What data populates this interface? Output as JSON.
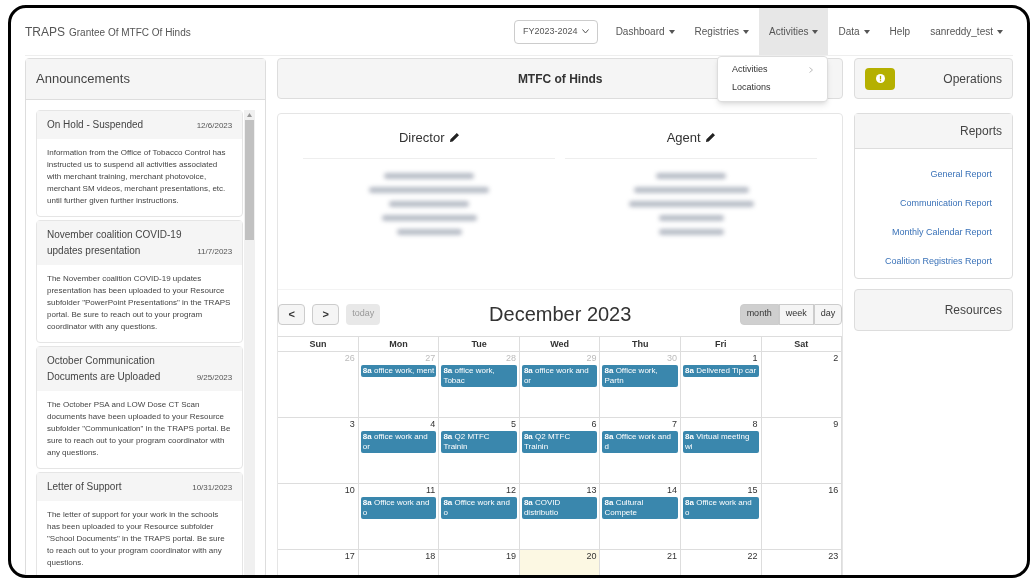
{
  "header": {
    "brand": "TRAPS",
    "subtitle": "Grantee Of MTFC Of Hinds",
    "fiscal_year": "FY2023-2024",
    "nav": [
      {
        "label": "Dashboard",
        "caret": true,
        "expanded": false
      },
      {
        "label": "Registries",
        "caret": true,
        "expanded": false
      },
      {
        "label": "Activities",
        "caret": true,
        "expanded": true
      },
      {
        "label": "Data",
        "caret": true,
        "expanded": false
      },
      {
        "label": "Help",
        "caret": false,
        "expanded": false
      },
      {
        "label": "sanreddy_test",
        "caret": true,
        "expanded": false
      }
    ],
    "dropdown": [
      {
        "label": "Activities",
        "submenu": true
      },
      {
        "label": "Locations",
        "submenu": false
      }
    ]
  },
  "announcements": {
    "title": "Announcements",
    "items": [
      {
        "title": "On Hold - Suspended",
        "date": "12/6/2023",
        "body": "Information from the Office of Tobacco Control has instructed us to suspend all activities associated with merchant training, merchant photovoice, merchant SM videos, merchant presentations, etc. until further given further instructions."
      },
      {
        "title": "November coalition COVID-19 updates presentation",
        "date": "11/7/2023",
        "body": "The November coalition COVID-19 updates presentation has been uploaded to your Resource subfolder \"PowerPoint Presentations\" in the TRAPS portal. Be sure to reach out to your program coordinator with any questions."
      },
      {
        "title": "October Communication Documents are Uploaded",
        "date": "9/25/2023",
        "body": "The October PSA and LOW Dose CT Scan documents have been uploaded to your Resource subfolder \"Communication\" in the TRAPS portal. Be sure to reach out to your program coordinator with any questions."
      },
      {
        "title": "Letter of Support",
        "date": "10/31/2023",
        "body": "The letter of support for your work in the schools has been uploaded to your Resource subfolder \"School Documents\" in the TRAPS portal. Be sure to reach out to your program coordinator with any questions."
      }
    ]
  },
  "org": {
    "title": "MTFC of Hinds",
    "contacts": [
      {
        "role": "Director"
      },
      {
        "role": "Agent"
      }
    ]
  },
  "calendar": {
    "title": "December 2023",
    "prev": "<",
    "next": ">",
    "today": "today",
    "views": [
      {
        "label": "month",
        "selected": true
      },
      {
        "label": "week",
        "selected": false
      },
      {
        "label": "day",
        "selected": false
      }
    ],
    "weekdays": [
      "Sun",
      "Mon",
      "Tue",
      "Wed",
      "Thu",
      "Fri",
      "Sat"
    ],
    "weeks": [
      [
        {
          "day": "26",
          "other_month": true,
          "today": false
        },
        {
          "day": "27",
          "other_month": true,
          "today": false,
          "events": [
            {
              "time": "8a",
              "title": "office work, ment"
            }
          ]
        },
        {
          "day": "28",
          "other_month": true,
          "today": false,
          "events": [
            {
              "time": "8a",
              "title": "office work, Tobac"
            }
          ]
        },
        {
          "day": "29",
          "other_month": true,
          "today": false,
          "events": [
            {
              "time": "8a",
              "title": "office work and or"
            }
          ]
        },
        {
          "day": "30",
          "other_month": true,
          "today": false,
          "events": [
            {
              "time": "8a",
              "title": "Office work, Partn"
            }
          ]
        },
        {
          "day": "1",
          "other_month": false,
          "today": false,
          "events": [
            {
              "time": "8a",
              "title": "Delivered Tip car"
            }
          ]
        },
        {
          "day": "2",
          "other_month": false,
          "today": false
        }
      ],
      [
        {
          "day": "3",
          "other_month": false,
          "today": false
        },
        {
          "day": "4",
          "other_month": false,
          "today": false,
          "events": [
            {
              "time": "8a",
              "title": "office work and or"
            }
          ]
        },
        {
          "day": "5",
          "other_month": false,
          "today": false,
          "events": [
            {
              "time": "8a",
              "title": "Q2 MTFC Trainin"
            }
          ]
        },
        {
          "day": "6",
          "other_month": false,
          "today": false,
          "events": [
            {
              "time": "8a",
              "title": "Q2 MTFC Trainin"
            }
          ]
        },
        {
          "day": "7",
          "other_month": false,
          "today": false,
          "events": [
            {
              "time": "8a",
              "title": "Office work and d"
            }
          ]
        },
        {
          "day": "8",
          "other_month": false,
          "today": false,
          "events": [
            {
              "time": "8a",
              "title": "Virtual meeting wi"
            }
          ]
        },
        {
          "day": "9",
          "other_month": false,
          "today": false
        }
      ],
      [
        {
          "day": "10",
          "other_month": false,
          "today": false
        },
        {
          "day": "11",
          "other_month": false,
          "today": false,
          "events": [
            {
              "time": "8a",
              "title": "Office work and o"
            }
          ]
        },
        {
          "day": "12",
          "other_month": false,
          "today": false,
          "events": [
            {
              "time": "8a",
              "title": "Office work and o"
            }
          ]
        },
        {
          "day": "13",
          "other_month": false,
          "today": false,
          "events": [
            {
              "time": "8a",
              "title": "COVID distributio"
            }
          ]
        },
        {
          "day": "14",
          "other_month": false,
          "today": false,
          "events": [
            {
              "time": "8a",
              "title": "Cultural Compete"
            }
          ]
        },
        {
          "day": "15",
          "other_month": false,
          "today": false,
          "events": [
            {
              "time": "8a",
              "title": "Office work and o"
            }
          ]
        },
        {
          "day": "16",
          "other_month": false,
          "today": false
        }
      ],
      [
        {
          "day": "17",
          "other_month": false,
          "today": false
        },
        {
          "day": "18",
          "other_month": false,
          "today": false
        },
        {
          "day": "19",
          "other_month": false,
          "today": false
        },
        {
          "day": "20",
          "other_month": false,
          "today": true
        },
        {
          "day": "21",
          "other_month": false,
          "today": false
        },
        {
          "day": "22",
          "other_month": false,
          "today": false
        },
        {
          "day": "23",
          "other_month": false,
          "today": false
        }
      ]
    ]
  },
  "operations": {
    "title": "Operations"
  },
  "reports": {
    "title": "Reports",
    "links": [
      "General Report",
      "Communication Report",
      "Monthly Calendar Report",
      "Coalition Registries Report"
    ]
  },
  "resources": {
    "title": "Resources"
  }
}
